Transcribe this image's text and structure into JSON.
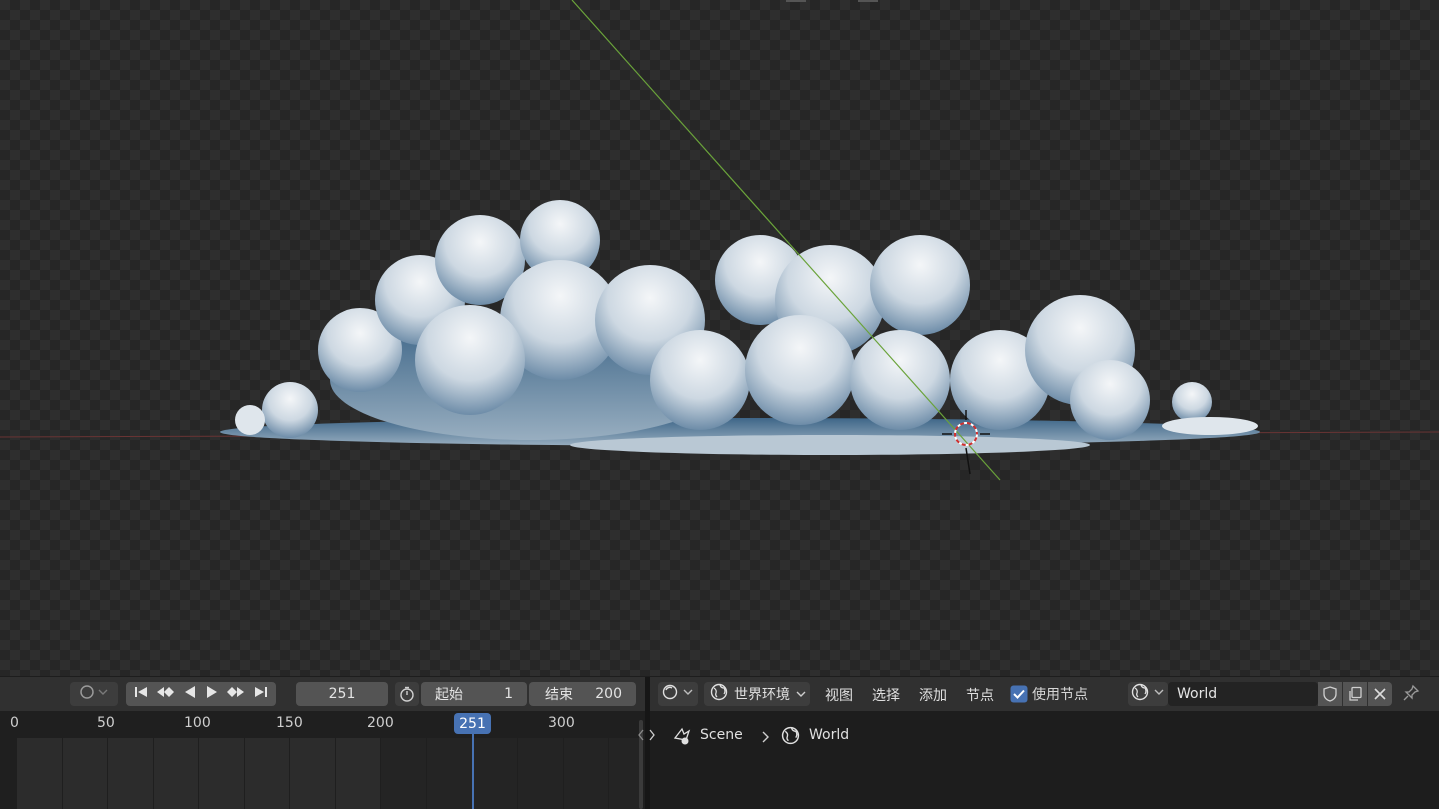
{
  "timeline": {
    "current_frame": "251",
    "start_label": "起始",
    "start_value": "1",
    "end_label": "结束",
    "end_value": "200",
    "ruler_ticks": [
      "0",
      "50",
      "100",
      "150",
      "200",
      "300"
    ],
    "playhead_label": "251"
  },
  "node_editor": {
    "context_dropdown": "世界环境",
    "menus": [
      "视图",
      "选择",
      "添加",
      "节点"
    ],
    "use_nodes_label": "使用节点",
    "use_nodes_checked": true,
    "datablock_name": "World",
    "breadcrumb": [
      "Scene",
      "World"
    ]
  },
  "colors": {
    "accent": "#4772b3",
    "button": "#545454",
    "header": "#303030"
  }
}
